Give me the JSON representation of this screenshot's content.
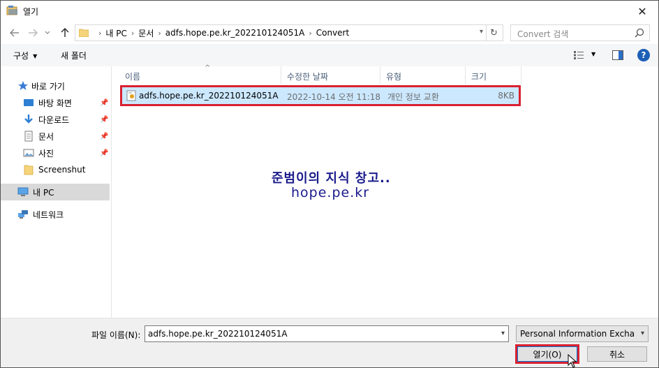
{
  "window": {
    "title": "열기",
    "close_glyph": "✕"
  },
  "nav": {
    "breadcrumbs": [
      "내 PC",
      "문서",
      "adfs.hope.pe.kr_202210124051A",
      "Convert"
    ],
    "search_placeholder": "Convert 검색"
  },
  "toolbar": {
    "organize": "구성",
    "new_folder": "새 폴더"
  },
  "sidebar": {
    "items": [
      {
        "label": "바로 가기",
        "icon": "star-icon",
        "pinned": false
      },
      {
        "label": "바탕 화면",
        "icon": "desktop-icon",
        "pinned": true
      },
      {
        "label": "다운로드",
        "icon": "download-icon",
        "pinned": true
      },
      {
        "label": "문서",
        "icon": "document-icon",
        "pinned": true
      },
      {
        "label": "사진",
        "icon": "picture-icon",
        "pinned": true
      },
      {
        "label": "Screenshut",
        "icon": "folder-icon",
        "pinned": false
      },
      {
        "label": "내 PC",
        "icon": "pc-icon",
        "pinned": false,
        "selected": true
      },
      {
        "label": "네트워크",
        "icon": "network-icon",
        "pinned": false
      }
    ]
  },
  "columns": {
    "name": "이름",
    "modified": "수정한 날짜",
    "type": "유형",
    "size": "크기"
  },
  "files": [
    {
      "name": "adfs.hope.pe.kr_202210124051A",
      "modified": "2022-10-14 오전 11:18",
      "type": "개인 정보 교환",
      "size": "8KB"
    }
  ],
  "watermark": {
    "line1": "준범이의 지식 창고..",
    "line2": "hope.pe.kr"
  },
  "footer": {
    "filename_label": "파일 이름(N):",
    "filename_value": "adfs.hope.pe.kr_202210124051A",
    "filter_value": "Personal Information Exchange",
    "open_label": "열기(O)",
    "cancel_label": "취소"
  },
  "colors": {
    "accent": "#0078d7",
    "highlight": "#d9212f",
    "selection": "#cce8ff"
  }
}
